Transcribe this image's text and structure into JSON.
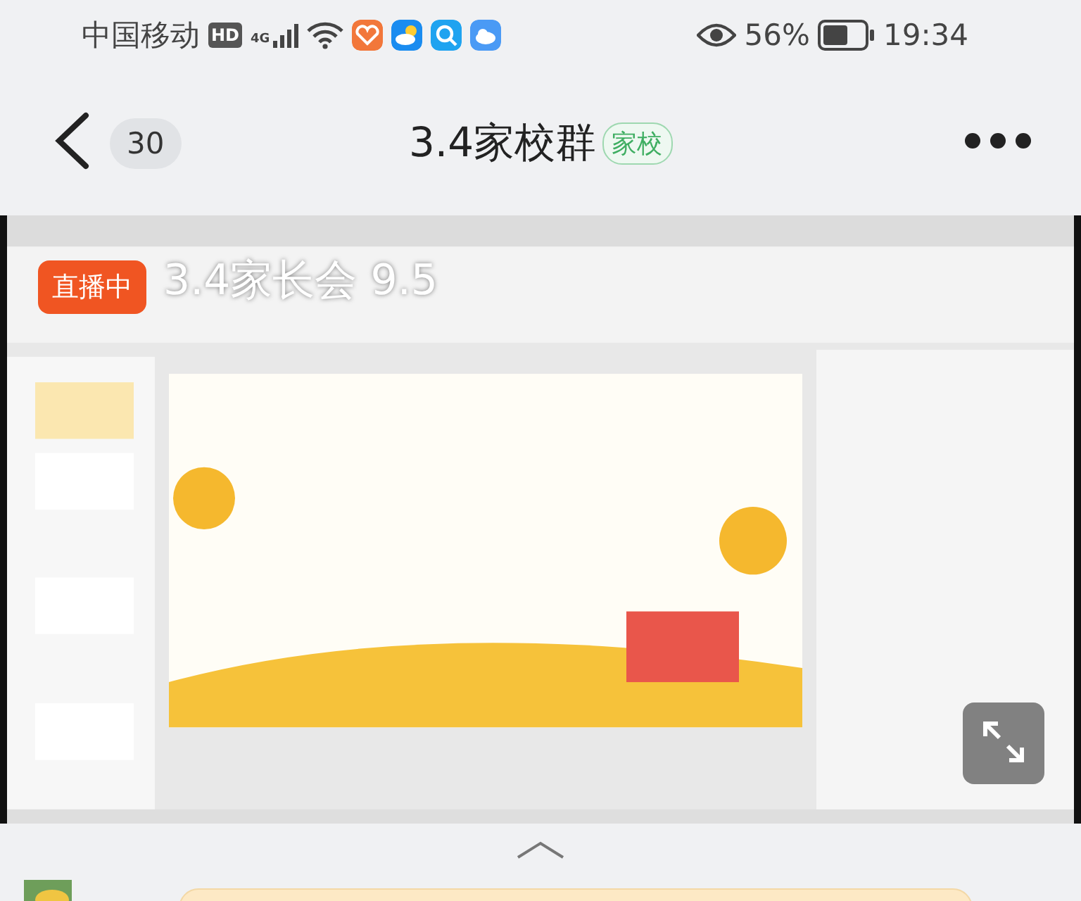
{
  "status_bar": {
    "carrier": "中国移动",
    "hd": "HD",
    "network": "4G",
    "battery": "56%",
    "time": "19:34"
  },
  "header": {
    "unread_count": "30",
    "title": "3.4家校群",
    "tag": "家校"
  },
  "live": {
    "kind": "picture",
    "badge": "直播中",
    "title": "3.4家长会 9.5"
  }
}
